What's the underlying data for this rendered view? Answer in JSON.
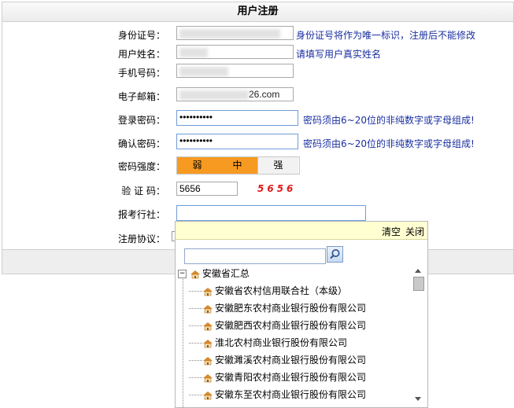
{
  "header": {
    "title": "用户注册"
  },
  "form": {
    "id_label": "身份证号：",
    "id_hint": "身份证号将作为唯一标识，注册后不能修改",
    "name_label": "用户姓名：",
    "name_hint": "请填写用户真实姓名",
    "phone_label": "手机号码：",
    "email_label": "电子邮箱：",
    "email_value_visible": "26.com",
    "pwd_label": "登录密码：",
    "pwd_value": "••••••••••",
    "pwd_hint": "密码须由6~20位的非纯数字或字母组成!",
    "confirm_label": "确认密码：",
    "confirm_value": "••••••••••",
    "confirm_hint": "密码须由6~20位的非纯数字或字母组成!",
    "strength_label": "密码强度：",
    "strength": {
      "weak": "弱",
      "medium": "中",
      "strong": "强",
      "level": "中"
    },
    "captcha_label": "验 证 码：",
    "captcha_value": "5656",
    "captcha_image": "5656",
    "agency_label": "报考行社：",
    "agency_value": "",
    "agreement_label": "注册协议："
  },
  "dropdown": {
    "clear": "清空",
    "close": "关闭",
    "search_value": "",
    "root": "安徽省汇总",
    "items": [
      "安徽省农村信用联合社（本级）",
      "安徽肥东农村商业银行股份有限公司",
      "安徽肥西农村商业银行股份有限公司",
      "淮北农村商业银行股份有限公司",
      "安徽濉溪农村商业银行股份有限公司",
      "安徽青阳农村商业银行股份有限公司",
      "安徽东至农村商业银行股份有限公司"
    ]
  },
  "colors": {
    "hint": "#1a2fa0",
    "captcha": "#e21a1a",
    "strength_on": "#f79a21",
    "dropdown_bar": "#ffffd2"
  },
  "icons": {
    "tree_node": "home-icon",
    "search": "search-icon"
  }
}
